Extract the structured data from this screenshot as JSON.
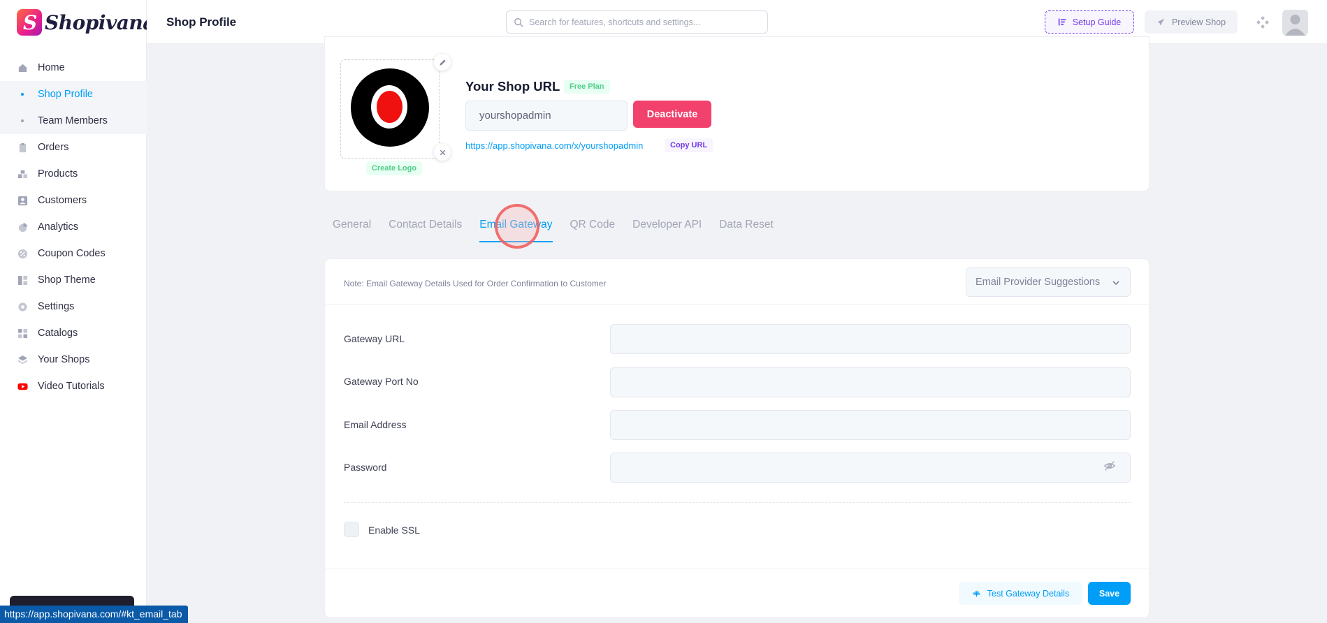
{
  "brand": {
    "name": "Shopivana"
  },
  "header": {
    "title": "Shop Profile",
    "search_placeholder": "Search for features, shortcuts and settings...",
    "setup_guide": "Setup Guide",
    "preview_shop": "Preview Shop"
  },
  "sidebar": {
    "items": [
      {
        "label": "Home",
        "icon": "home-icon"
      },
      {
        "label": "Shop Profile",
        "icon": "dot",
        "active": true
      },
      {
        "label": "Team Members",
        "icon": "dot"
      },
      {
        "label": "Orders",
        "icon": "clipboard-icon"
      },
      {
        "label": "Products",
        "icon": "products-icon"
      },
      {
        "label": "Customers",
        "icon": "user-icon"
      },
      {
        "label": "Analytics",
        "icon": "pie-chart-icon"
      },
      {
        "label": "Coupon Codes",
        "icon": "percent-icon"
      },
      {
        "label": "Shop Theme",
        "icon": "layout-icon"
      },
      {
        "label": "Settings",
        "icon": "gear-icon"
      },
      {
        "label": "Catalogs",
        "icon": "grid-icon"
      },
      {
        "label": "Your Shops",
        "icon": "layers-icon"
      },
      {
        "label": "Video Tutorials",
        "icon": "youtube-icon"
      }
    ]
  },
  "status_bar": {
    "url": "https://app.shopivana.com/#kt_email_tab"
  },
  "profile": {
    "create_logo": "Create Logo",
    "shop_url_title": "Your Shop URL",
    "plan_badge": "Free Plan",
    "shop_handle": "yourshopadmin",
    "deactivate": "Deactivate",
    "shop_link": "https://app.shopivana.com/x/yourshopadmin",
    "copy_url": "Copy URL"
  },
  "tabs": [
    {
      "label": "General"
    },
    {
      "label": "Contact Details"
    },
    {
      "label": "Email Gateway",
      "active": true
    },
    {
      "label": "QR Code"
    },
    {
      "label": "Developer API"
    },
    {
      "label": "Data Reset"
    }
  ],
  "email_form": {
    "note": "Note: Email Gateway Details Used for Order Confirmation to Customer",
    "provider_select": "Email Provider Suggestions",
    "fields": [
      {
        "label": "Gateway URL",
        "value": ""
      },
      {
        "label": "Gateway Port No",
        "value": ""
      },
      {
        "label": "Email Address",
        "value": ""
      },
      {
        "label": "Password",
        "value": ""
      }
    ],
    "ssl_label": "Enable SSL",
    "test_button": "Test Gateway Details",
    "save_button": "Save"
  },
  "colors": {
    "primary": "#009ef7",
    "danger": "#f1416c",
    "success": "#50cd89",
    "purple": "#7239ea"
  }
}
